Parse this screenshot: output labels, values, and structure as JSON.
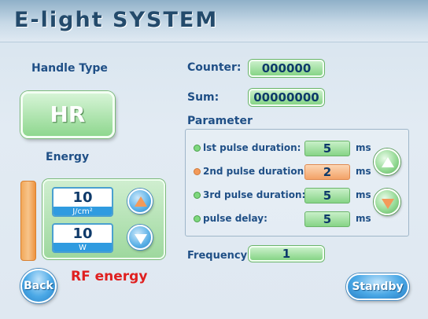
{
  "app": {
    "title": "E-light SYSTEM"
  },
  "handle": {
    "label": "Handle Type",
    "value": "HR"
  },
  "energy": {
    "label": "Energy",
    "fluence": {
      "value": "10",
      "unit": "J/cm²"
    },
    "power": {
      "value": "10",
      "unit": "W"
    }
  },
  "counter": {
    "label": "Counter:",
    "value": "000000"
  },
  "sum": {
    "label": "Sum:",
    "value": "00000000"
  },
  "parameter": {
    "title": "Parameter",
    "unit": "ms",
    "rows": [
      {
        "label": "lst pulse duration:",
        "value": "5",
        "status_color": "#7ed87e"
      },
      {
        "label": "2nd pulse duration:",
        "value": "2",
        "status_color": "#f39a5a"
      },
      {
        "label": "3rd pulse duration:",
        "value": "5",
        "status_color": "#7ed87e"
      },
      {
        "label": "pulse delay:",
        "value": "5",
        "status_color": "#7ed87e"
      }
    ]
  },
  "frequency": {
    "label": "Frequency:",
    "value": "1"
  },
  "status_message": "RF energy",
  "buttons": {
    "back": "Back",
    "standby": "Standby"
  },
  "icons": {
    "energy_up": "triangle-up-icon",
    "energy_down": "triangle-down-icon",
    "param_up": "triangle-up-icon",
    "param_down": "triangle-down-icon"
  },
  "colors": {
    "label_blue": "#1f4f86",
    "accent_green": "#86d486",
    "accent_orange": "#f3a267",
    "button_blue": "#4aa8e6",
    "alert_red": "#e02020"
  }
}
